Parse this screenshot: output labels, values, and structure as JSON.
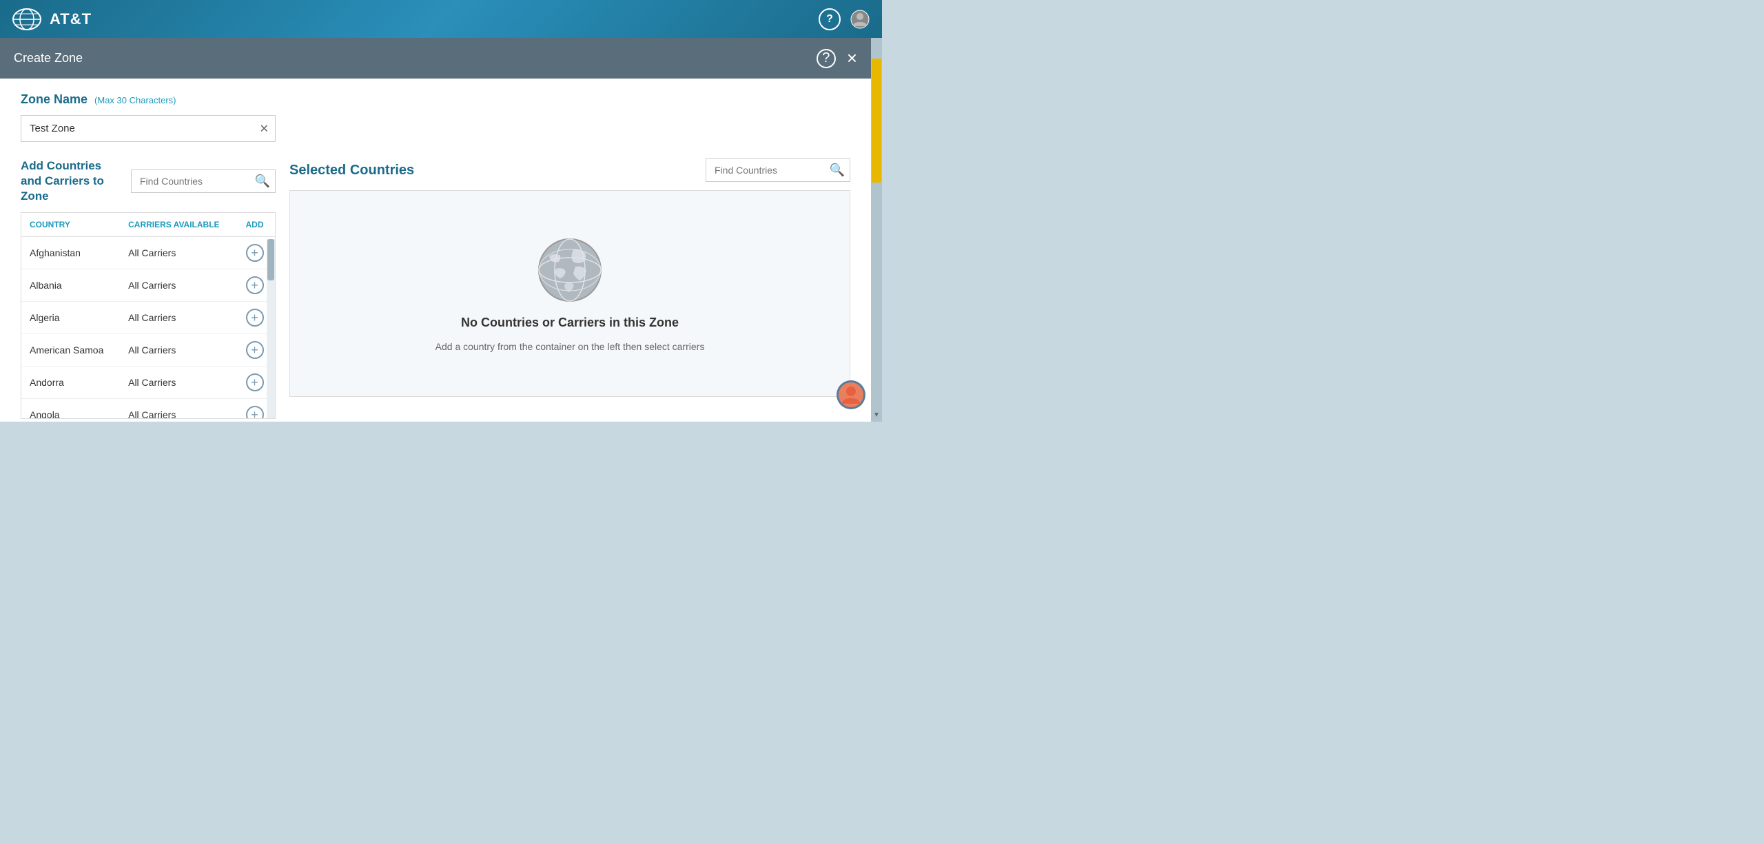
{
  "topBar": {
    "logoText": "AT&T",
    "helpIcon": "?",
    "userIcon": "person"
  },
  "modal": {
    "title": "Create Zone",
    "helpIcon": "?",
    "closeIcon": "×"
  },
  "zoneName": {
    "label": "Zone Name",
    "hint": "(Max 30 Characters)",
    "value": "Test Zone",
    "clearIcon": "✕"
  },
  "leftPanel": {
    "title": "Add Countries and Carriers to Zone",
    "findPlaceholder": "Find Countries",
    "searchIcon": "🔍",
    "table": {
      "columns": [
        "COUNTRY",
        "CARRIERS AVAILABLE",
        "ADD"
      ],
      "rows": [
        {
          "country": "Afghanistan",
          "carriers": "All Carriers"
        },
        {
          "country": "Albania",
          "carriers": "All Carriers"
        },
        {
          "country": "Algeria",
          "carriers": "All Carriers"
        },
        {
          "country": "American Samoa",
          "carriers": "All Carriers"
        },
        {
          "country": "Andorra",
          "carriers": "All Carriers"
        },
        {
          "country": "Angola",
          "carriers": "All Carriers"
        }
      ]
    }
  },
  "rightPanel": {
    "title": "Selected Countries",
    "findPlaceholder": "Find Countries",
    "searchIcon": "🔍",
    "emptyState": {
      "title": "No Countries or Carriers in this Zone",
      "subtitle": "Add a country from the container on the left then select carriers"
    }
  },
  "bgPlus": "+",
  "bgBars": "||"
}
